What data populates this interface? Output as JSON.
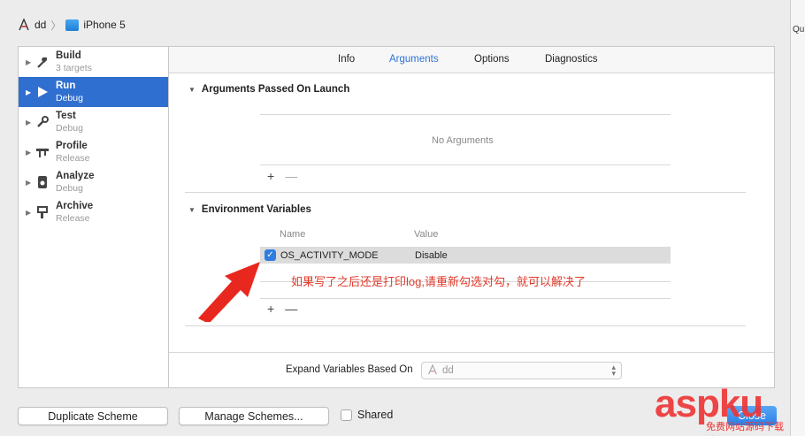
{
  "breadcrumb": {
    "project": "dd",
    "device": "iPhone 5"
  },
  "right_strip": {
    "text": "Qui"
  },
  "actions": [
    {
      "name": "Build",
      "sub": "3 targets",
      "icon": "hammer-icon"
    },
    {
      "name": "Run",
      "sub": "Debug",
      "icon": "play-icon"
    },
    {
      "name": "Test",
      "sub": "Debug",
      "icon": "wrench-icon"
    },
    {
      "name": "Profile",
      "sub": "Release",
      "icon": "caliper-icon"
    },
    {
      "name": "Analyze",
      "sub": "Debug",
      "icon": "analyze-icon"
    },
    {
      "name": "Archive",
      "sub": "Release",
      "icon": "archive-icon"
    }
  ],
  "tabs": [
    "Info",
    "Arguments",
    "Options",
    "Diagnostics"
  ],
  "active_tab": "Arguments",
  "args": {
    "title": "Arguments Passed On Launch",
    "empty": "No Arguments",
    "plus": "+",
    "minus": "—"
  },
  "env": {
    "title": "Environment Variables",
    "col_name": "Name",
    "col_value": "Value",
    "rows": [
      {
        "name": "OS_ACTIVITY_MODE",
        "value": "Disable",
        "checked": true
      }
    ],
    "plus": "+",
    "minus": "—"
  },
  "annotation": "如果写了之后还是打印log,请重新勾选对勾，就可以解决了",
  "expand": {
    "label": "Expand Variables Based On",
    "value": "dd"
  },
  "buttons": {
    "duplicate": "Duplicate Scheme",
    "manage": "Manage Schemes...",
    "shared": "Shared",
    "close": "Close"
  },
  "watermark": {
    "main": "aspku",
    "sub": "免费网站源码下载站!"
  },
  "colors": {
    "selection": "#2f6fd0",
    "accent": "#2b74d9",
    "annotation": "#e03a2a"
  }
}
